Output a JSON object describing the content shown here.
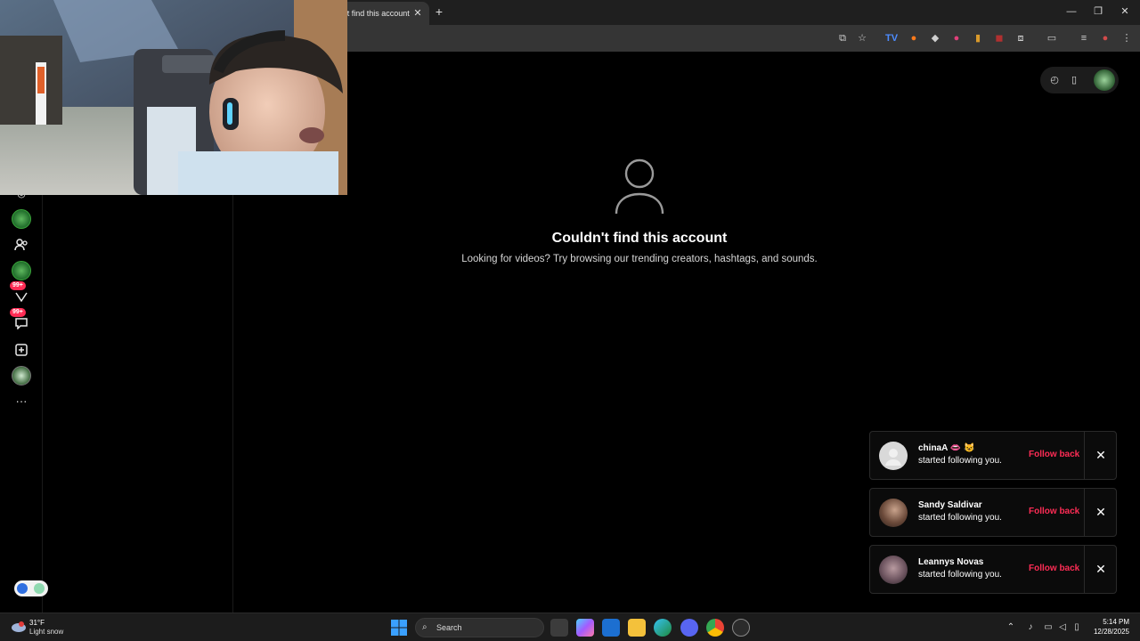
{
  "browser": {
    "tab_title": "'t find this account",
    "tab_close": "✕",
    "new_tab": "+",
    "window_controls": {
      "minimize": "—",
      "restore": "❐",
      "close": "✕"
    }
  },
  "page": {
    "empty_state": {
      "title": "Couldn't find this account",
      "subtitle": "Looking for videos? Try browsing our trending creators, hashtags, and sounds."
    },
    "left_nav": {
      "badges": [
        "99+",
        "99+"
      ],
      "more_label": "···"
    },
    "notifications": [
      {
        "name": "chinaA 👄 😺",
        "text": "started following you.",
        "action": "Follow back",
        "close": "✕"
      },
      {
        "name": "Sandy Saldivar",
        "text": "started following you.",
        "action": "Follow back",
        "close": "✕"
      },
      {
        "name": "Leannys Novas",
        "text": "started following you.",
        "action": "Follow back",
        "close": "✕"
      }
    ]
  },
  "taskbar": {
    "weather": {
      "temp": "31°F",
      "desc": "Light snow"
    },
    "search_label": "Search",
    "clock": {
      "time": "5:14 PM",
      "date": "12/28/2025"
    }
  },
  "colors": {
    "accent": "#fe2c55",
    "background": "#000000",
    "taskbar": "#1c1c1c"
  }
}
